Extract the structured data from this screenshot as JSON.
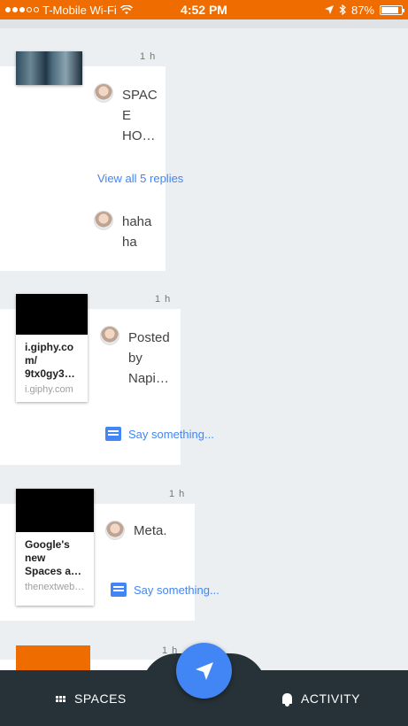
{
  "status_bar": {
    "carrier": "T-Mobile Wi-Fi",
    "time": "4:52 PM",
    "battery": "87%",
    "battery_level": 0.87
  },
  "posts": [
    {
      "time": "1 h",
      "comments": [
        {
          "text": "SPAC\nE\nHO…"
        },
        {
          "text": "haha\nha"
        }
      ],
      "view_replies": "View all 5 replies"
    },
    {
      "time": "1 h",
      "link_card": {
        "title": "i.giphy.co\nm/\n9tx0gy3…",
        "domain": "i.giphy.com"
      },
      "comment": "Posted\nby\nNapi…",
      "say_something": "Say something..."
    },
    {
      "time": "1 h",
      "link_card": {
        "title": "Google's\nnew\nSpaces a…",
        "domain": "thenextweb…"
      },
      "comment": "Meta.",
      "say_something": "Say something..."
    },
    {
      "time": "1 h"
    }
  ],
  "bottom_nav": {
    "spaces_label": "SPACES",
    "activity_label": "ACTIVITY"
  },
  "colors": {
    "status_bar": "#ef6c00",
    "accent": "#4285f4",
    "nav_background": "#263238"
  }
}
